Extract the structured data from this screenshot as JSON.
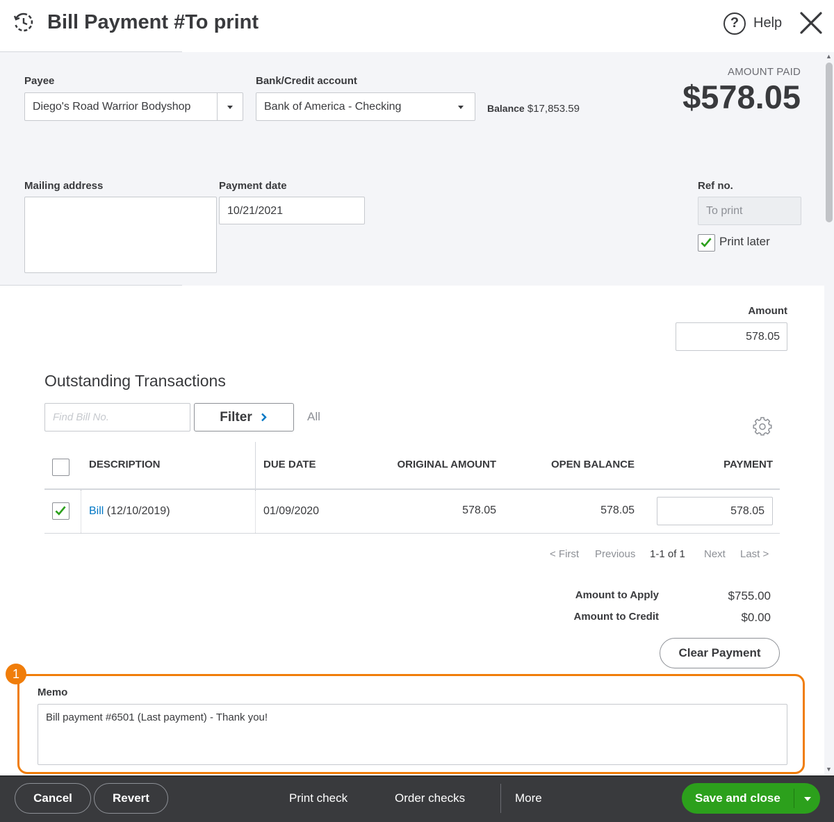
{
  "header": {
    "title": "Bill Payment #To print",
    "help_label": "Help"
  },
  "form": {
    "payee_label": "Payee",
    "payee_value": "Diego's Road Warrior Bodyshop",
    "bank_label": "Bank/Credit account",
    "bank_value": "Bank of America - Checking",
    "balance_label": "Balance",
    "balance_value": "$17,853.59",
    "amount_paid_label": "AMOUNT PAID",
    "amount_paid_value": "$578.05",
    "mailing_label": "Mailing address",
    "mailing_value": "",
    "payment_date_label": "Payment date",
    "payment_date_value": "10/21/2021",
    "ref_label": "Ref no.",
    "ref_placeholder": "To print",
    "print_later_label": "Print later",
    "print_later_checked": true,
    "amount_label": "Amount",
    "amount_value": "578.05"
  },
  "outstanding": {
    "title": "Outstanding Transactions",
    "find_placeholder": "Find Bill No.",
    "filter_label": "Filter",
    "filter_value": "All",
    "columns": [
      "DESCRIPTION",
      "DUE DATE",
      "ORIGINAL AMOUNT",
      "OPEN BALANCE",
      "PAYMENT"
    ],
    "rows": [
      {
        "checked": true,
        "desc_link": "Bill",
        "desc_rest": "(12/10/2019)",
        "due_date": "01/09/2020",
        "original_amount": "578.05",
        "open_balance": "578.05",
        "payment": "578.05"
      }
    ],
    "pagination": {
      "first": "< First",
      "previous": "Previous",
      "range": "1-1 of 1",
      "next": "Next",
      "last": "Last >"
    },
    "amount_to_apply_label": "Amount to Apply",
    "amount_to_apply_value": "$755.00",
    "amount_to_credit_label": "Amount to Credit",
    "amount_to_credit_value": "$0.00",
    "clear_payment_label": "Clear Payment"
  },
  "memo": {
    "step_number": "1",
    "label": "Memo",
    "value": "Bill payment #6501 (Last payment) - Thank you!"
  },
  "footer": {
    "cancel_label": "Cancel",
    "revert_label": "Revert",
    "print_check_label": "Print check",
    "order_checks_label": "Order checks",
    "more_label": "More",
    "save_close_label": "Save and close"
  },
  "colors": {
    "accent_green": "#2ca01c",
    "highlight_orange": "#f07d0a",
    "link_blue": "#0077c5",
    "footer_dark": "#393a3d"
  },
  "icons": [
    "history-icon",
    "help-icon",
    "close-icon",
    "chevron-right-icon",
    "gear-icon",
    "check-icon",
    "caret-down-icon"
  ]
}
